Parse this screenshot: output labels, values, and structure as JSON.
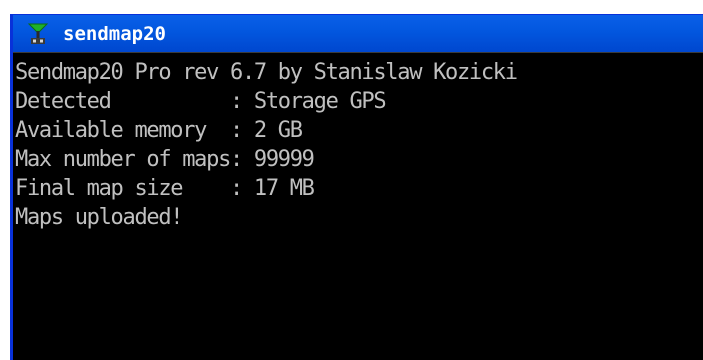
{
  "window": {
    "title": "sendmap20",
    "icon": "gps-antenna-icon"
  },
  "console": {
    "lines": [
      "Sendmap20 Pro rev 6.7 by Stanislaw Kozicki",
      "Detected          : Storage GPS",
      "Available memory  : 2 GB",
      "Max number of maps: 99999",
      "Final map size    : 17 MB",
      "Maps uploaded!"
    ]
  },
  "colors": {
    "titlebar": "#0358e0",
    "console_bg": "#000000",
    "console_text": "#c0c0c0"
  }
}
